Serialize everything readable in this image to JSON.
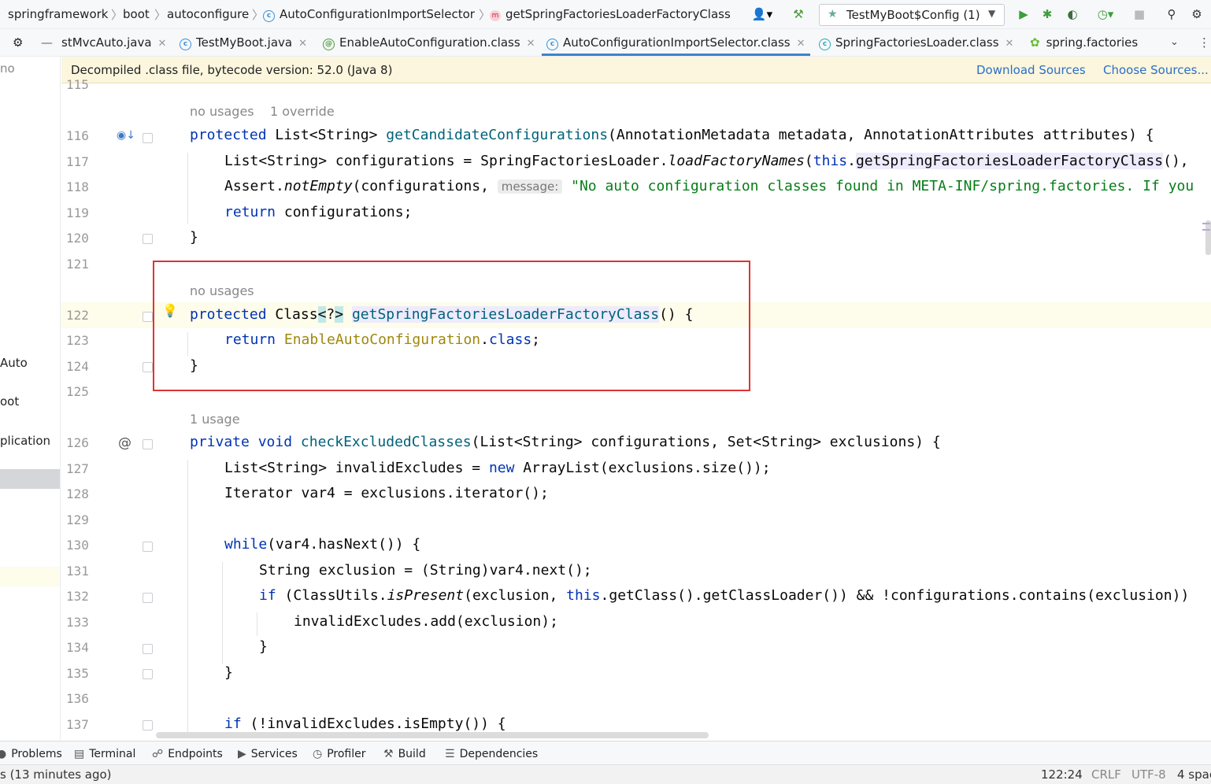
{
  "breadcrumb": {
    "items": [
      "springframework",
      "boot",
      "autoconfigure",
      "AutoConfigurationImportSelector",
      "getSpringFactoriesLoaderFactoryClass"
    ],
    "separator": "〉"
  },
  "toolbar": {
    "run_config": "TestMyBoot$Config (1)",
    "icons": [
      "user-icon",
      "build-hammer-icon",
      "run-icon",
      "debug-icon",
      "coverage-icon",
      "profile-icon",
      "stop-icon",
      "search-icon"
    ]
  },
  "tabs": [
    {
      "label": "stMvcAuto.java",
      "icon": ""
    },
    {
      "label": "TestMyBoot.java",
      "icon": "C"
    },
    {
      "label": "EnableAutoConfiguration.class",
      "icon": "@"
    },
    {
      "label": "AutoConfigurationImportSelector.class",
      "icon": "C",
      "active": true
    },
    {
      "label": "SpringFactoriesLoader.class",
      "icon": "C"
    },
    {
      "label": "spring.factories",
      "icon": ""
    }
  ],
  "banner": {
    "text": "Decompiled .class file, bytecode version: 52.0 (Java 8)",
    "download": "Download Sources",
    "choose": "Choose Sources..."
  },
  "left_panel": {
    "items": [
      "no",
      "Auto",
      "oot",
      "plication"
    ]
  },
  "hints": {
    "h116": "no usages",
    "h116b": "1 override",
    "h122": "no usages",
    "h126": "1 usage"
  },
  "line_numbers": [
    "115",
    "116",
    "117",
    "118",
    "119",
    "120",
    "121",
    "122",
    "123",
    "124",
    "125",
    "126",
    "127",
    "128",
    "129",
    "130",
    "131",
    "132",
    "133",
    "134",
    "135",
    "136",
    "137"
  ],
  "code": {
    "l116": [
      "protected",
      " List<String> ",
      "getCandidateConfigurations",
      "(AnnotationMetadata metadata, AnnotationAttributes attributes) {"
    ],
    "l117": [
      "List<String> configurations = SpringFactoriesLoader.",
      "loadFactoryNames",
      "(",
      "this",
      ".",
      "getSpringFactoriesLoaderFactoryClass",
      "(), "
    ],
    "l118": [
      "Assert.",
      "notEmpty",
      "(configurations, ",
      "message:",
      " ",
      "\"No auto configuration classes found in META-INF/spring.factories. If you"
    ],
    "l119": [
      "return",
      " configurations;"
    ],
    "l120": "}",
    "l122": [
      "protected",
      " Class",
      "<",
      "?",
      ">",
      " ",
      "getSpringFactoriesLoaderFactoryClass",
      "() {"
    ],
    "l123": [
      "return",
      " ",
      "EnableAutoConfiguration",
      ".",
      "class",
      ";"
    ],
    "l124": "}",
    "l126": [
      "private void",
      " ",
      "checkExcludedClasses",
      "(List<String> configurations, Set<String> exclusions) {"
    ],
    "l127": [
      "List<String> invalidExcludes = ",
      "new",
      " ArrayList(exclusions.size());"
    ],
    "l128": "Iterator var4 = exclusions.iterator();",
    "l130": [
      "while",
      "(var4.hasNext()) {"
    ],
    "l131": "String exclusion = (String)var4.next();",
    "l132": [
      "if",
      " (ClassUtils.",
      "isPresent",
      "(exclusion, ",
      "this",
      ".getClass().getClassLoader()) && !configurations.contains(exclusion))"
    ],
    "l133": "invalidExcludes.add(exclusion);",
    "l134": "}",
    "l135": "}",
    "l137": [
      "if",
      " (!invalidExcludes.isEmpty()) {"
    ]
  },
  "tool_windows": [
    "Problems",
    "Terminal",
    "Endpoints",
    "Services",
    "Profiler",
    "Build",
    "Dependencies"
  ],
  "status": {
    "left": "s (13 minutes ago)",
    "position": "122:24",
    "line_sep": "CRLF",
    "encoding": "UTF-8",
    "indent": "4 spac"
  },
  "colors": {
    "keyword": "#0033b3",
    "method": "#00627a",
    "string": "#067d17",
    "annotation_box": "#e03333",
    "link": "#2a6fc9",
    "banner_bg": "#fbf6dd"
  }
}
